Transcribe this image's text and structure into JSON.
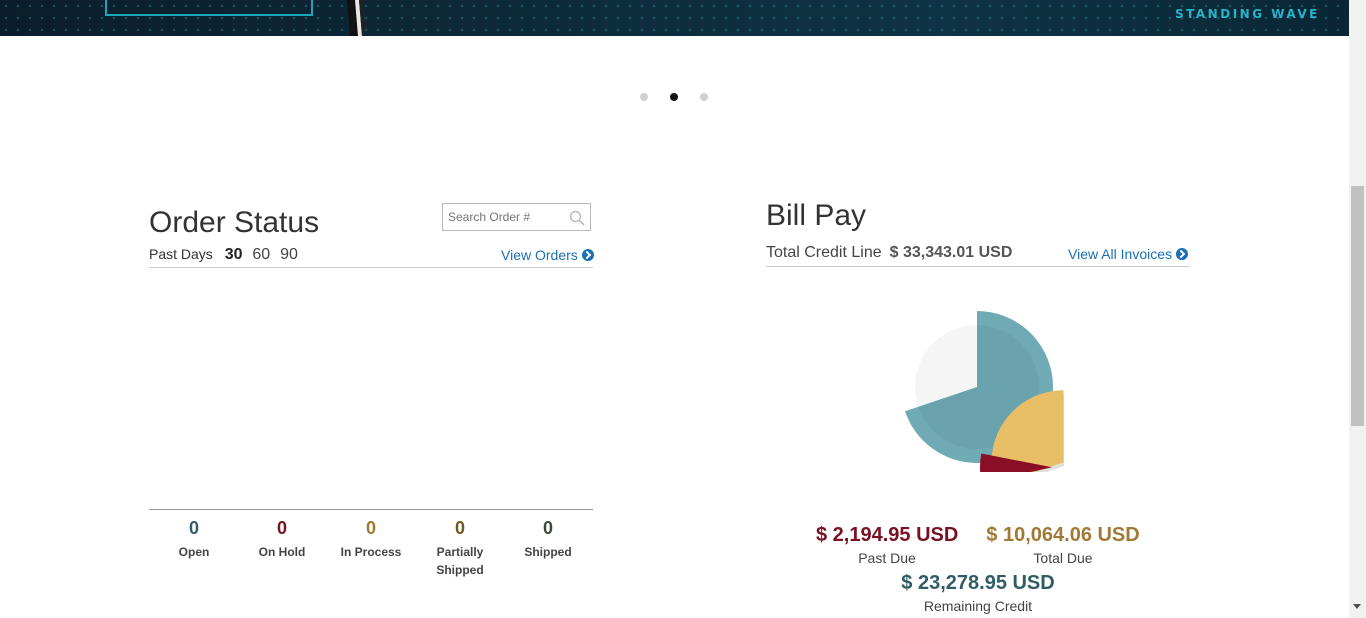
{
  "banner": {
    "ad_text": "STANDING WAVE"
  },
  "carousel": {
    "active_index": 1,
    "count": 3
  },
  "order_status": {
    "title": "Order Status",
    "search_placeholder": "Search Order #",
    "past_days_label": "Past Days",
    "days": [
      "30",
      "60",
      "90"
    ],
    "active_day": "30",
    "view_orders": "View Orders",
    "statuses": [
      {
        "count": "0",
        "label": "Open",
        "color": "#2f5d70"
      },
      {
        "count": "0",
        "label": "On Hold",
        "color": "#7a1024"
      },
      {
        "count": "0",
        "label": "In Process",
        "color": "#a07a35"
      },
      {
        "count": "0",
        "label": "Partially Shipped",
        "color": "#6b5a1e"
      },
      {
        "count": "0",
        "label": "Shipped",
        "color": "#3a4a3a"
      }
    ]
  },
  "bill_pay": {
    "title": "Bill Pay",
    "credit_line_label": "Total Credit Line",
    "credit_line_amount": "$ 33,343.01 USD",
    "view_invoices": "View All Invoices",
    "past_due": {
      "value": "$ 2,194.95 USD",
      "label": "Past Due",
      "color": "#7a1024"
    },
    "total_due": {
      "value": "$ 10,064.06 USD",
      "label": "Total Due",
      "color": "#a07a35"
    },
    "remaining_credit": {
      "value": "$ 23,278.95 USD",
      "label": "Remaining Credit",
      "color": "#2f5d63"
    },
    "pie_colors": {
      "remaining": "#6faab5",
      "total_due": "#e8bf66",
      "past_due": "#8b0e27"
    }
  }
}
